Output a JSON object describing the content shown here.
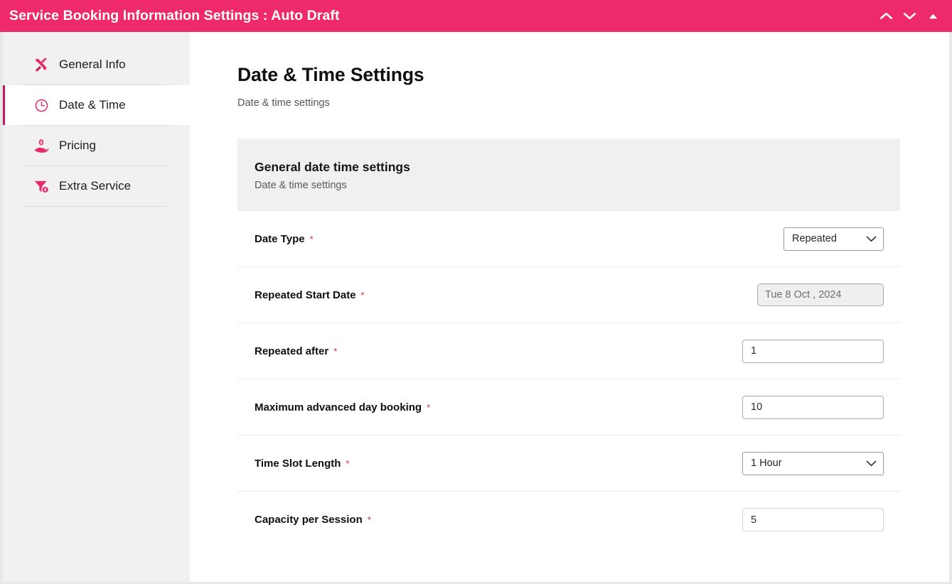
{
  "window": {
    "title": "Service Booking Information Settings : Auto Draft",
    "controls": [
      {
        "name": "chevron-up-icon",
        "label": "Collapse up"
      },
      {
        "name": "chevron-down-icon",
        "label": "Expand down"
      },
      {
        "name": "triangle-up-icon",
        "label": "Maximize"
      }
    ],
    "accent_color": "#ee2a6b"
  },
  "sidebar": {
    "items": [
      {
        "label": "General Info",
        "icon": "tools-icon",
        "active": false
      },
      {
        "label": "Date & Time",
        "icon": "clock-icon",
        "active": true
      },
      {
        "label": "Pricing",
        "icon": "hand-dollar-icon",
        "active": false
      },
      {
        "label": "Extra Service",
        "icon": "funnel-dollar-icon",
        "active": false
      }
    ]
  },
  "main": {
    "title": "Date & Time Settings",
    "subtitle": "Date & time settings",
    "card": {
      "header_title": "General date time settings",
      "header_subtitle": "Date & time settings",
      "rows": [
        {
          "label": "Date Type",
          "required": "*",
          "control": "select",
          "value": "Repeated",
          "options": [
            "Repeated"
          ]
        },
        {
          "label": "Repeated Start Date",
          "required": "*",
          "control": "date",
          "value": "Tue 8 Oct , 2024"
        },
        {
          "label": "Repeated after",
          "required": "*",
          "control": "text",
          "value": "1"
        },
        {
          "label": "Maximum advanced day booking",
          "required": "*",
          "control": "text",
          "value": "10"
        },
        {
          "label": "Time Slot Length",
          "required": "*",
          "control": "select",
          "value": "1 Hour",
          "options": [
            "1 Hour"
          ]
        },
        {
          "label": "Capacity per Session",
          "required": "*",
          "control": "text",
          "value": "5"
        }
      ]
    }
  }
}
